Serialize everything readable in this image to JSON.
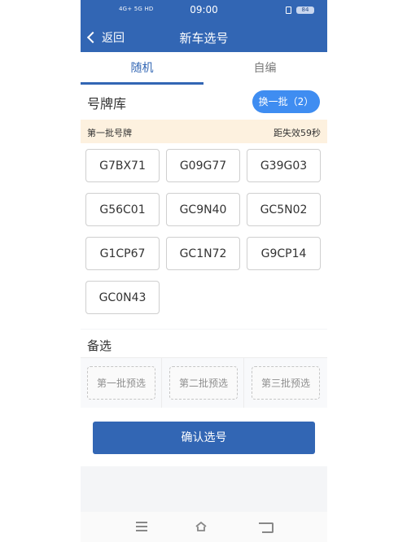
{
  "status_bar": {
    "signal_text": "4G+ 5G HD",
    "time": "09:00",
    "battery": "84"
  },
  "header": {
    "back_label": "返回",
    "title": "新车选号"
  },
  "tabs": [
    {
      "label": "随机"
    },
    {
      "label": "自编"
    }
  ],
  "plate_library": {
    "title": "号牌库",
    "refresh_button": "换一批（2）",
    "batch_label": "第一批号牌",
    "countdown": "距失效59秒",
    "plates": [
      "G7BX71",
      "G09G77",
      "G39G03",
      "G56C01",
      "GC9N40",
      "GC5N02",
      "G1CP67",
      "GC1N72",
      "G9CP14",
      "GC0N43"
    ]
  },
  "alternates": {
    "title": "备选",
    "slots": [
      "第一批预选",
      "第二批预选",
      "第三批预选"
    ]
  },
  "confirm_button": "确认选号",
  "colors": {
    "primary": "#3266b4",
    "accent_button": "#3f8df1",
    "notice_bg": "#fdf1df"
  },
  "icons": {
    "back": "chevron-left-icon",
    "menu": "menu-icon",
    "home": "home-icon",
    "back_nav": "back-icon"
  }
}
